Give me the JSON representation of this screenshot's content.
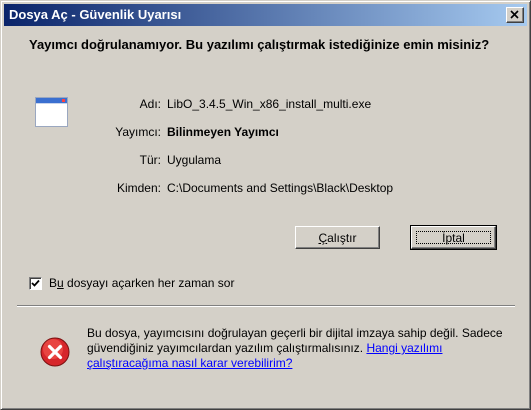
{
  "window": {
    "title": "Dosya Aç - Güvenlik Uyarısı"
  },
  "dialog": {
    "question": "Yayımcı doğrulanamıyor. Bu yazılımı çalıştırmak istediğinize emin misiniz?",
    "fields": {
      "name_label": "Adı:",
      "name_value": "LibO_3.4.5_Win_x86_install_multi.exe",
      "publisher_label": "Yayımcı:",
      "publisher_value": "Bilinmeyen Yayımcı",
      "type_label": "Tür:",
      "type_value": "Uygulama",
      "from_label": "Kimden:",
      "from_value": "C:\\Documents and Settings\\Black\\Desktop"
    },
    "buttons": {
      "run_accel": "Ç",
      "run_rest": "alıştır",
      "cancel_label": "İptal"
    },
    "checkbox": {
      "checked": true,
      "label_pre": "B",
      "label_accel": "u",
      "label_post": " dosyayı açarken her zaman sor"
    },
    "warning": {
      "text": "Bu dosya, yayımcısını doğrulayan geçerli bir dijital imzaya sahip değil. Sadece güvendiğiniz yayımcılardan yazılım çalıştırmalısınız. ",
      "link_text": "Hangi yazılımı çalıştıracağıma nasıl karar verebilirim?"
    }
  },
  "icons": {
    "close": "close-icon",
    "file": "application-file-icon",
    "warning": "error-shield-icon",
    "check": "check-icon"
  },
  "colors": {
    "titlebar_start": "#0a246a",
    "titlebar_end": "#a6caf0",
    "face": "#d4d0c8",
    "link": "#0000ff",
    "error_red": "#d6262b"
  }
}
